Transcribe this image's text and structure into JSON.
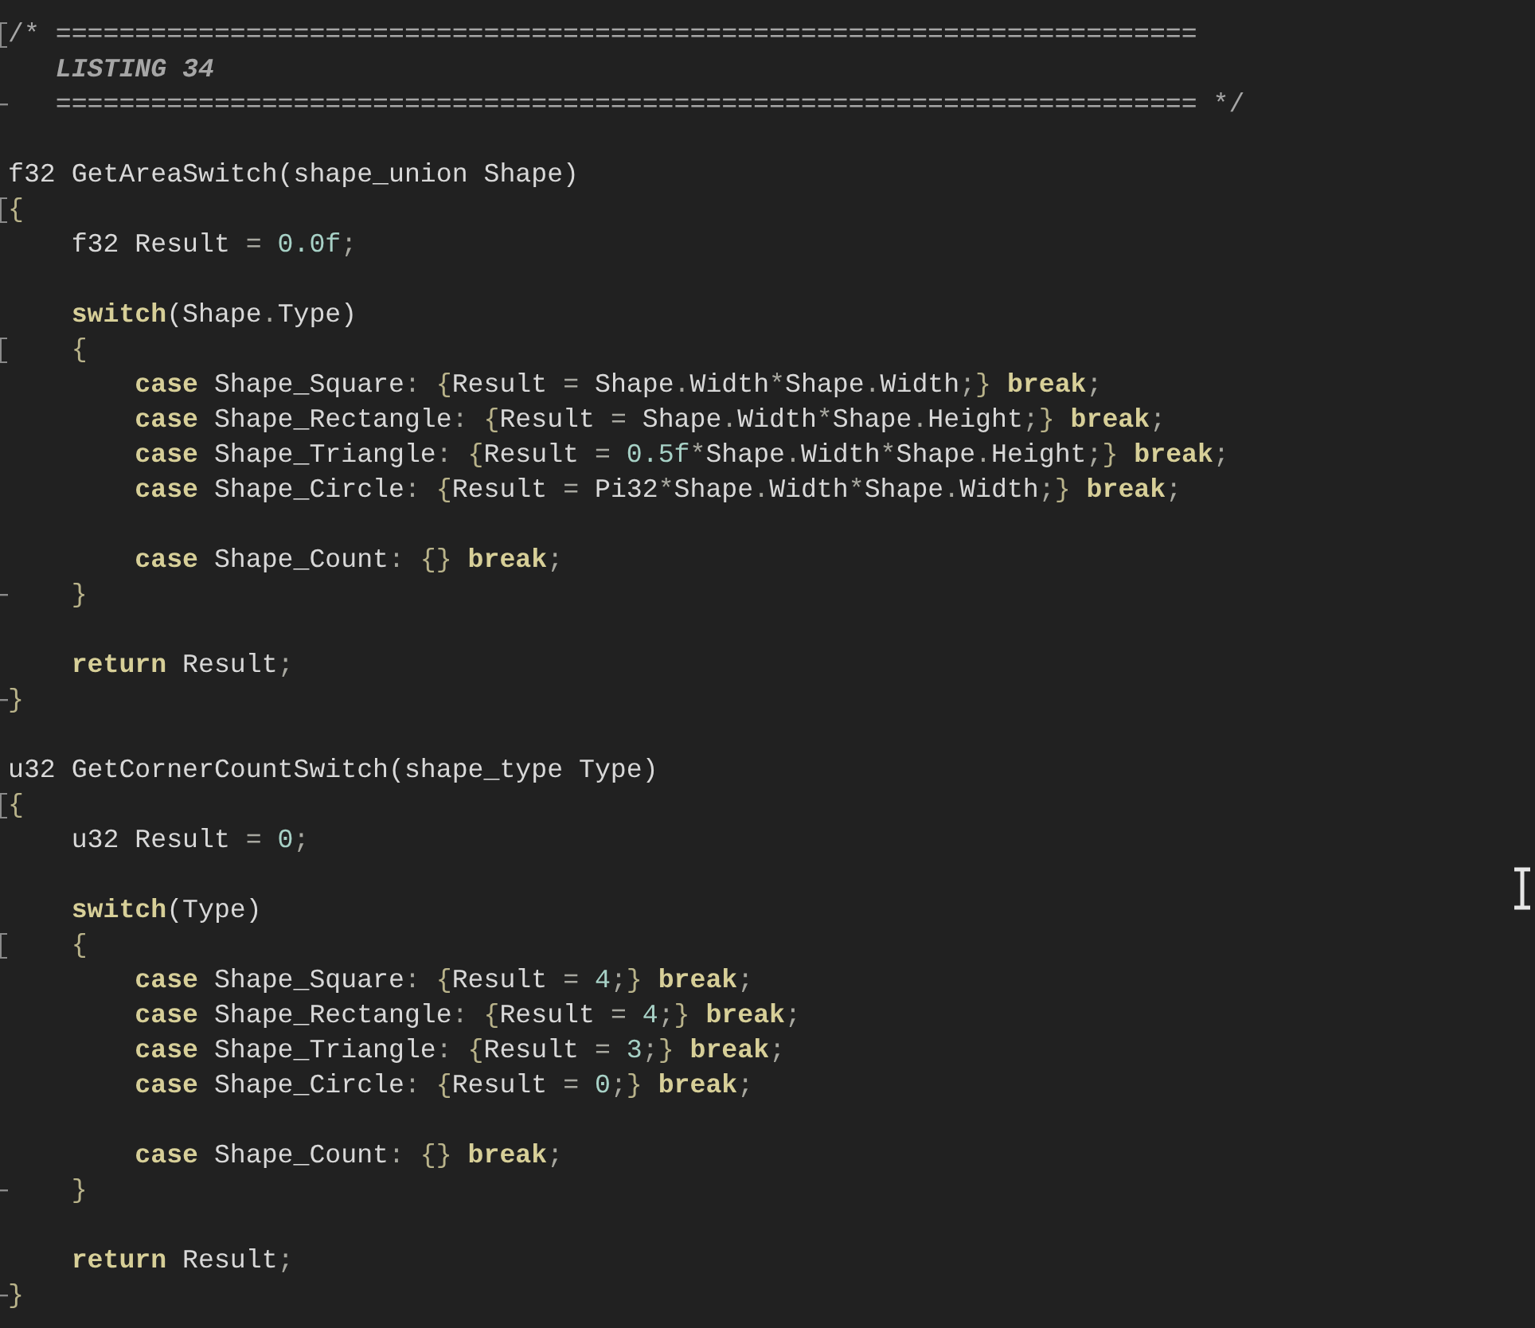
{
  "editor": {
    "blocks": [
      {
        "lines": [
          {
            "fold_start": true,
            "tokens": [
              {
                "kind": "comment",
                "text": "/* ========================================================================"
              }
            ]
          },
          {
            "tokens": [
              {
                "kind": "comment_italic",
                "text": "   LISTING 34"
              }
            ]
          },
          {
            "fold_end": true,
            "tokens": [
              {
                "kind": "comment",
                "text": "   ======================================================================== */"
              }
            ]
          }
        ]
      },
      {
        "lines": [
          {
            "tokens": [
              {
                "kind": "plain",
                "text": "f32 GetAreaSwitch(shape_union Shape)"
              }
            ]
          },
          {
            "fold_start": true,
            "tokens": [
              {
                "kind": "brace",
                "text": "{"
              }
            ]
          },
          {
            "tokens": [
              {
                "kind": "plain",
                "text": "    f32 Result "
              },
              {
                "kind": "operator",
                "text": "="
              },
              {
                "kind": "number",
                "text": " 0.0f"
              },
              {
                "kind": "operator",
                "text": ";"
              }
            ]
          }
        ]
      },
      {
        "lines": [
          {
            "tokens": [
              {
                "kind": "keyword",
                "text": "    switch"
              },
              {
                "kind": "plain",
                "text": "(Shape"
              },
              {
                "kind": "operator",
                "text": "."
              },
              {
                "kind": "plain",
                "text": "Type)"
              }
            ]
          },
          {
            "fold_start": true,
            "tokens": [
              {
                "kind": "brace",
                "text": "    {"
              }
            ]
          },
          {
            "tokens": [
              {
                "kind": "keyword",
                "text": "        case"
              },
              {
                "kind": "plain",
                "text": " Shape_Square"
              },
              {
                "kind": "operator",
                "text": ":"
              },
              {
                "kind": "brace",
                "text": " {"
              },
              {
                "kind": "plain",
                "text": "Result "
              },
              {
                "kind": "operator",
                "text": "="
              },
              {
                "kind": "plain",
                "text": " Shape"
              },
              {
                "kind": "operator",
                "text": "."
              },
              {
                "kind": "plain",
                "text": "Width"
              },
              {
                "kind": "operator",
                "text": "*"
              },
              {
                "kind": "plain",
                "text": "Shape"
              },
              {
                "kind": "operator",
                "text": "."
              },
              {
                "kind": "plain",
                "text": "Width"
              },
              {
                "kind": "operator",
                "text": ";"
              },
              {
                "kind": "brace",
                "text": "}"
              },
              {
                "kind": "keyword",
                "text": " break"
              },
              {
                "kind": "operator",
                "text": ";"
              }
            ]
          },
          {
            "tokens": [
              {
                "kind": "keyword",
                "text": "        case"
              },
              {
                "kind": "plain",
                "text": " Shape_Rectangle"
              },
              {
                "kind": "operator",
                "text": ":"
              },
              {
                "kind": "brace",
                "text": " {"
              },
              {
                "kind": "plain",
                "text": "Result "
              },
              {
                "kind": "operator",
                "text": "="
              },
              {
                "kind": "plain",
                "text": " Shape"
              },
              {
                "kind": "operator",
                "text": "."
              },
              {
                "kind": "plain",
                "text": "Width"
              },
              {
                "kind": "operator",
                "text": "*"
              },
              {
                "kind": "plain",
                "text": "Shape"
              },
              {
                "kind": "operator",
                "text": "."
              },
              {
                "kind": "plain",
                "text": "Height"
              },
              {
                "kind": "operator",
                "text": ";"
              },
              {
                "kind": "brace",
                "text": "}"
              },
              {
                "kind": "keyword",
                "text": " break"
              },
              {
                "kind": "operator",
                "text": ";"
              }
            ]
          },
          {
            "tokens": [
              {
                "kind": "keyword",
                "text": "        case"
              },
              {
                "kind": "plain",
                "text": " Shape_Triangle"
              },
              {
                "kind": "operator",
                "text": ":"
              },
              {
                "kind": "brace",
                "text": " {"
              },
              {
                "kind": "plain",
                "text": "Result "
              },
              {
                "kind": "operator",
                "text": "="
              },
              {
                "kind": "number",
                "text": " 0.5f"
              },
              {
                "kind": "operator",
                "text": "*"
              },
              {
                "kind": "plain",
                "text": "Shape"
              },
              {
                "kind": "operator",
                "text": "."
              },
              {
                "kind": "plain",
                "text": "Width"
              },
              {
                "kind": "operator",
                "text": "*"
              },
              {
                "kind": "plain",
                "text": "Shape"
              },
              {
                "kind": "operator",
                "text": "."
              },
              {
                "kind": "plain",
                "text": "Height"
              },
              {
                "kind": "operator",
                "text": ";"
              },
              {
                "kind": "brace",
                "text": "}"
              },
              {
                "kind": "keyword",
                "text": " break"
              },
              {
                "kind": "operator",
                "text": ";"
              }
            ]
          },
          {
            "tokens": [
              {
                "kind": "keyword",
                "text": "        case"
              },
              {
                "kind": "plain",
                "text": " Shape_Circle"
              },
              {
                "kind": "operator",
                "text": ":"
              },
              {
                "kind": "brace",
                "text": " {"
              },
              {
                "kind": "plain",
                "text": "Result "
              },
              {
                "kind": "operator",
                "text": "="
              },
              {
                "kind": "plain",
                "text": " Pi32"
              },
              {
                "kind": "operator",
                "text": "*"
              },
              {
                "kind": "plain",
                "text": "Shape"
              },
              {
                "kind": "operator",
                "text": "."
              },
              {
                "kind": "plain",
                "text": "Width"
              },
              {
                "kind": "operator",
                "text": "*"
              },
              {
                "kind": "plain",
                "text": "Shape"
              },
              {
                "kind": "operator",
                "text": "."
              },
              {
                "kind": "plain",
                "text": "Width"
              },
              {
                "kind": "operator",
                "text": ";"
              },
              {
                "kind": "brace",
                "text": "}"
              },
              {
                "kind": "keyword",
                "text": " break"
              },
              {
                "kind": "operator",
                "text": ";"
              }
            ]
          }
        ]
      },
      {
        "lines": [
          {
            "tokens": [
              {
                "kind": "keyword",
                "text": "        case"
              },
              {
                "kind": "plain",
                "text": " Shape_Count"
              },
              {
                "kind": "operator",
                "text": ":"
              },
              {
                "kind": "brace",
                "text": " {}"
              },
              {
                "kind": "keyword",
                "text": " break"
              },
              {
                "kind": "operator",
                "text": ";"
              }
            ]
          },
          {
            "fold_end": true,
            "tokens": [
              {
                "kind": "brace",
                "text": "    }"
              }
            ]
          }
        ]
      },
      {
        "lines": [
          {
            "tokens": [
              {
                "kind": "keyword",
                "text": "    return"
              },
              {
                "kind": "plain",
                "text": " Result"
              },
              {
                "kind": "operator",
                "text": ";"
              }
            ]
          },
          {
            "fold_end": true,
            "tokens": [
              {
                "kind": "brace",
                "text": "}"
              }
            ]
          }
        ]
      },
      {
        "lines": [
          {
            "tokens": [
              {
                "kind": "plain",
                "text": "u32 GetCornerCountSwitch(shape_type Type)"
              }
            ]
          },
          {
            "fold_start": true,
            "tokens": [
              {
                "kind": "brace",
                "text": "{"
              }
            ]
          },
          {
            "tokens": [
              {
                "kind": "plain",
                "text": "    u32 Result "
              },
              {
                "kind": "operator",
                "text": "="
              },
              {
                "kind": "number",
                "text": " 0"
              },
              {
                "kind": "operator",
                "text": ";"
              }
            ]
          }
        ]
      },
      {
        "lines": [
          {
            "tokens": [
              {
                "kind": "keyword",
                "text": "    switch"
              },
              {
                "kind": "plain",
                "text": "(Type)"
              }
            ]
          },
          {
            "fold_start": true,
            "tokens": [
              {
                "kind": "brace",
                "text": "    {"
              }
            ]
          },
          {
            "tokens": [
              {
                "kind": "keyword",
                "text": "        case"
              },
              {
                "kind": "plain",
                "text": " Shape_Square"
              },
              {
                "kind": "operator",
                "text": ":"
              },
              {
                "kind": "brace",
                "text": " {"
              },
              {
                "kind": "plain",
                "text": "Result "
              },
              {
                "kind": "operator",
                "text": "="
              },
              {
                "kind": "number",
                "text": " 4"
              },
              {
                "kind": "operator",
                "text": ";"
              },
              {
                "kind": "brace",
                "text": "}"
              },
              {
                "kind": "keyword",
                "text": " break"
              },
              {
                "kind": "operator",
                "text": ";"
              }
            ]
          },
          {
            "tokens": [
              {
                "kind": "keyword",
                "text": "        case"
              },
              {
                "kind": "plain",
                "text": " Shape_Rectangle"
              },
              {
                "kind": "operator",
                "text": ":"
              },
              {
                "kind": "brace",
                "text": " {"
              },
              {
                "kind": "plain",
                "text": "Result "
              },
              {
                "kind": "operator",
                "text": "="
              },
              {
                "kind": "number",
                "text": " 4"
              },
              {
                "kind": "operator",
                "text": ";"
              },
              {
                "kind": "brace",
                "text": "}"
              },
              {
                "kind": "keyword",
                "text": " break"
              },
              {
                "kind": "operator",
                "text": ";"
              }
            ]
          },
          {
            "tokens": [
              {
                "kind": "keyword",
                "text": "        case"
              },
              {
                "kind": "plain",
                "text": " Shape_Triangle"
              },
              {
                "kind": "operator",
                "text": ":"
              },
              {
                "kind": "brace",
                "text": " {"
              },
              {
                "kind": "plain",
                "text": "Result "
              },
              {
                "kind": "operator",
                "text": "="
              },
              {
                "kind": "number",
                "text": " 3"
              },
              {
                "kind": "operator",
                "text": ";"
              },
              {
                "kind": "brace",
                "text": "}"
              },
              {
                "kind": "keyword",
                "text": " break"
              },
              {
                "kind": "operator",
                "text": ";"
              }
            ]
          },
          {
            "tokens": [
              {
                "kind": "keyword",
                "text": "        case"
              },
              {
                "kind": "plain",
                "text": " Shape_Circle"
              },
              {
                "kind": "operator",
                "text": ":"
              },
              {
                "kind": "brace",
                "text": " {"
              },
              {
                "kind": "plain",
                "text": "Result "
              },
              {
                "kind": "operator",
                "text": "="
              },
              {
                "kind": "number",
                "text": " 0"
              },
              {
                "kind": "operator",
                "text": ";"
              },
              {
                "kind": "brace",
                "text": "}"
              },
              {
                "kind": "keyword",
                "text": " break"
              },
              {
                "kind": "operator",
                "text": ";"
              }
            ]
          }
        ]
      },
      {
        "lines": [
          {
            "tokens": [
              {
                "kind": "keyword",
                "text": "        case"
              },
              {
                "kind": "plain",
                "text": " Shape_Count"
              },
              {
                "kind": "operator",
                "text": ":"
              },
              {
                "kind": "brace",
                "text": " {}"
              },
              {
                "kind": "keyword",
                "text": " break"
              },
              {
                "kind": "operator",
                "text": ";"
              }
            ]
          },
          {
            "fold_end": true,
            "tokens": [
              {
                "kind": "brace",
                "text": "    }"
              }
            ]
          }
        ]
      },
      {
        "lines": [
          {
            "tokens": [
              {
                "kind": "keyword",
                "text": "    return"
              },
              {
                "kind": "plain",
                "text": " Result"
              },
              {
                "kind": "operator",
                "text": ";"
              }
            ]
          },
          {
            "fold_end": true,
            "tokens": [
              {
                "kind": "brace",
                "text": "}"
              }
            ]
          }
        ]
      }
    ]
  }
}
